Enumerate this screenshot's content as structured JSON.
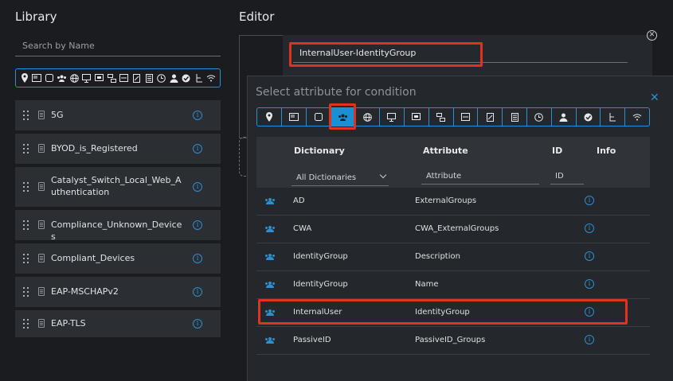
{
  "library": {
    "title": "Library",
    "search_placeholder": "Search by Name",
    "items": [
      {
        "label": "5G"
      },
      {
        "label": "BYOD_is_Registered"
      },
      {
        "label": "Catalyst_Switch_Local_Web_Authentication"
      },
      {
        "label": "Compliance_Unknown_Devices"
      },
      {
        "label": "Compliant_Devices"
      },
      {
        "label": "EAP-MSCHAPv2"
      },
      {
        "label": "EAP-TLS"
      }
    ]
  },
  "editor": {
    "title": "Editor",
    "name_value": "InternalUser-IdentityGroup"
  },
  "panel": {
    "title": "Select attribute for condition",
    "columns": {
      "dictionary": "Dictionary",
      "attribute": "Attribute",
      "id": "ID",
      "info": "Info"
    },
    "filters": {
      "dictionary": "All Dictionaries",
      "attribute": "Attribute",
      "id": "ID"
    },
    "rows": [
      {
        "dictionary": "AD",
        "attribute": "ExternalGroups"
      },
      {
        "dictionary": "CWA",
        "attribute": "CWA_ExternalGroups"
      },
      {
        "dictionary": "IdentityGroup",
        "attribute": "Description"
      },
      {
        "dictionary": "IdentityGroup",
        "attribute": "Name"
      },
      {
        "dictionary": "InternalUser",
        "attribute": "IdentityGroup"
      },
      {
        "dictionary": "PassiveID",
        "attribute": "PassiveID_Groups"
      }
    ]
  },
  "colors": {
    "accent": "#2b8fd0",
    "highlight": "#e0331f",
    "active_tab": "#1a8fd4"
  }
}
